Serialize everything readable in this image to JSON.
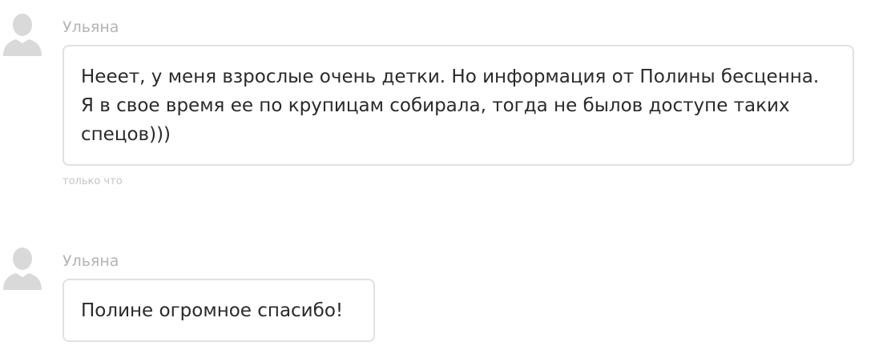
{
  "messages": [
    {
      "author": "Ульяна",
      "avatar_icon": "user-silhouette-icon",
      "text": "Нееет, у меня взрослые очень детки. Но информация от Полины бесценна. Я в свое время ее по крупицам собирала, тогда не былов доступе таких спецов)))",
      "timestamp": "только что"
    },
    {
      "author": "Ульяна",
      "avatar_icon": "user-silhouette-icon",
      "text": "Полине огромное спасибо!"
    }
  ],
  "colors": {
    "author": "#b4b4b4",
    "text": "#2a2a2a",
    "border": "#e1e1e1",
    "timestamp": "#c4c4c4",
    "avatar": "#d9d9d9"
  }
}
